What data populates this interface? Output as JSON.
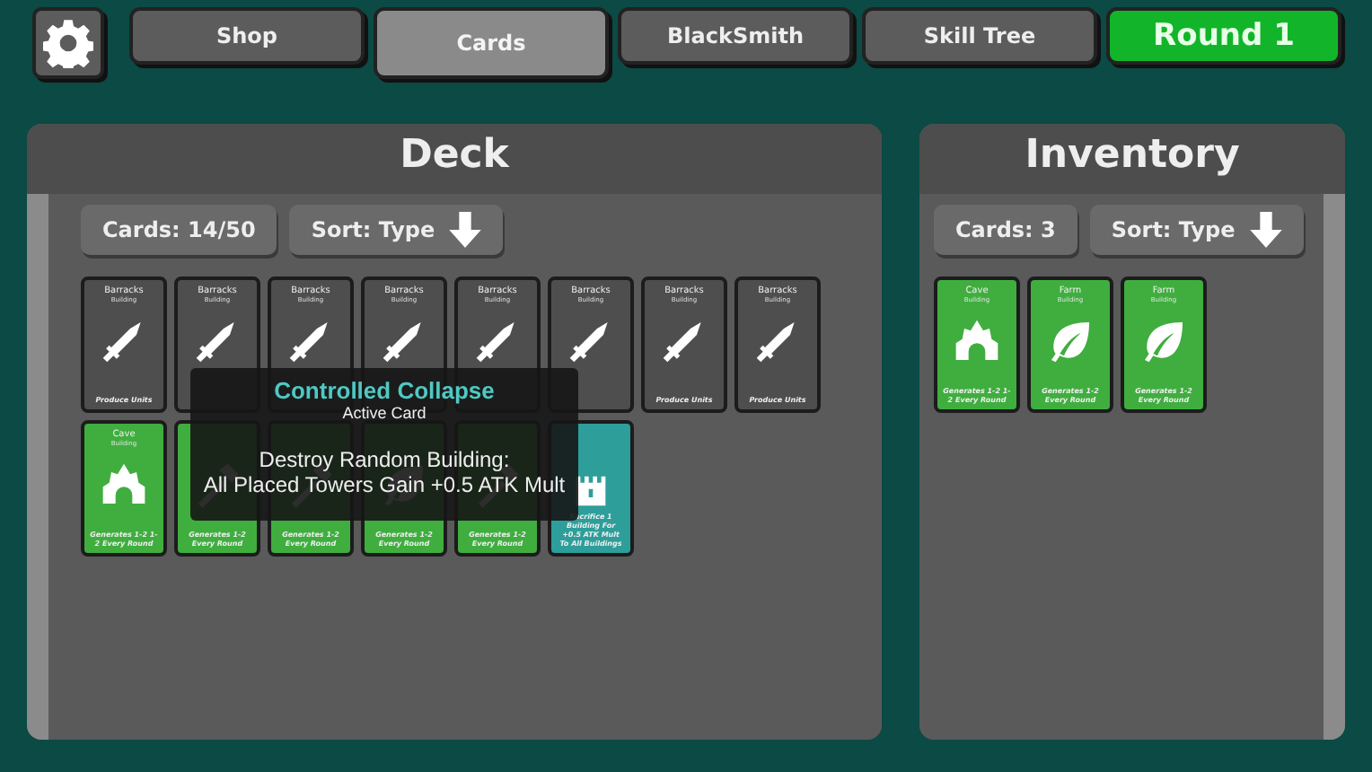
{
  "tabs": [
    {
      "label": "Shop",
      "selected": false
    },
    {
      "label": "Cards",
      "selected": true
    },
    {
      "label": "BlackSmith",
      "selected": false
    },
    {
      "label": "Skill Tree",
      "selected": false
    }
  ],
  "round_button": "Round 1",
  "deck": {
    "title": "Deck",
    "count": "Cards: 14/50",
    "sort": "Sort: Type",
    "cards": [
      {
        "title": "Barracks",
        "subtitle": "Building",
        "kind": "sword",
        "color": "#4e4e4e",
        "text": "Produce Units"
      },
      {
        "title": "Barracks",
        "subtitle": "Building",
        "kind": "sword",
        "color": "#4e4e4e"
      },
      {
        "title": "Barracks",
        "subtitle": "Building",
        "kind": "sword",
        "color": "#4e4e4e"
      },
      {
        "title": "Barracks",
        "subtitle": "Building",
        "kind": "sword",
        "color": "#4e4e4e"
      },
      {
        "title": "Barracks",
        "subtitle": "Building",
        "kind": "sword",
        "color": "#4e4e4e"
      },
      {
        "title": "Barracks",
        "subtitle": "Building",
        "kind": "sword",
        "color": "#4e4e4e"
      },
      {
        "title": "Barracks",
        "subtitle": "Building",
        "kind": "sword",
        "color": "#4e4e4e",
        "text": "Produce Units"
      },
      {
        "title": "Barracks",
        "subtitle": "Building",
        "kind": "sword",
        "color": "#4e4e4e",
        "text": "Produce Units"
      },
      {
        "title": "Cave",
        "subtitle": "Building",
        "kind": "cave",
        "color": "#3fae3f",
        "text": "Generates 1-2 1-2 Every Round"
      },
      {
        "kind": "axe",
        "color": "#3fae3f",
        "text": "Generates 1-2 Every Round"
      },
      {
        "kind": "axe",
        "color": "#3fae3f",
        "text": "Generates 1-2 Every Round"
      },
      {
        "kind": "leaf",
        "color": "#3fae3f",
        "text": "Generates 1-2 Every Round"
      },
      {
        "kind": "axe",
        "color": "#3fae3f",
        "text": "Generates 1-2 Every Round"
      },
      {
        "kind": "tower",
        "color": "#2e9e9a",
        "text": "Sacrifice 1 Building For +0.5 ATK Mult To All Buildings"
      }
    ]
  },
  "tooltip": {
    "title": "Controlled Collapse",
    "subtitle": "Active Card",
    "lines": [
      "Destroy Random Building:",
      "All Placed Towers Gain +0.5 ATK Mult"
    ]
  },
  "inventory": {
    "title": "Inventory",
    "count": "Cards: 3",
    "sort": "Sort: Type",
    "cards": [
      {
        "title": "Cave",
        "subtitle": "Building",
        "kind": "cave",
        "color": "#3fae3f",
        "text": "Generates 1-2 1-2 Every Round"
      },
      {
        "title": "Farm",
        "subtitle": "Building",
        "kind": "leaf",
        "color": "#3fae3f",
        "text": "Generates 1-2 Every Round"
      },
      {
        "title": "Farm",
        "subtitle": "Building",
        "kind": "leaf",
        "color": "#3fae3f",
        "text": "Generates 1-2 Every Round"
      }
    ]
  }
}
